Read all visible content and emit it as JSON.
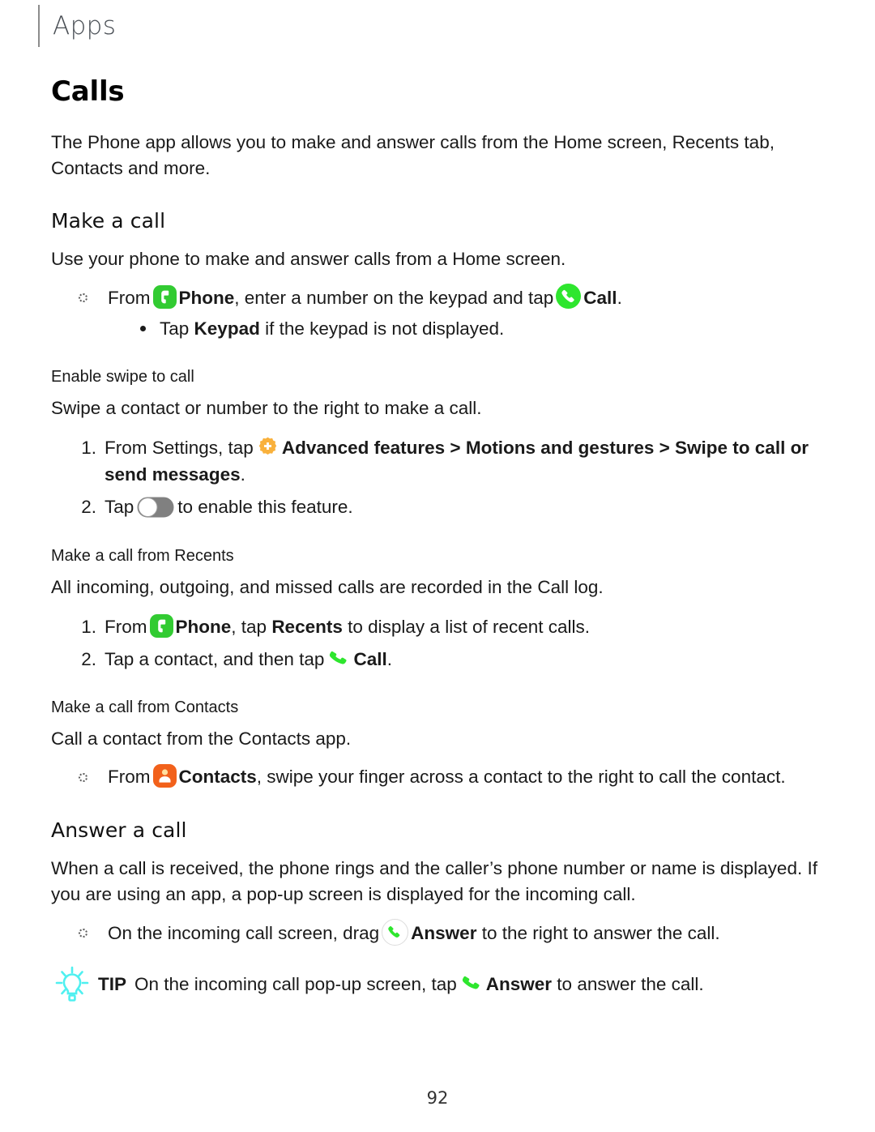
{
  "header": {
    "running_title": "Apps"
  },
  "chapter": {
    "title": "Calls",
    "intro": "The Phone app allows you to make and answer calls from the Home screen, Recents tab, Contacts and more."
  },
  "sections": {
    "make_a_call": {
      "title": "Make a call",
      "intro": "Use your phone to make and answer calls from a Home screen.",
      "bullet": {
        "text_1": "From",
        "app_label": "Phone",
        "text_2": ", enter a number on the keypad and tap",
        "action_label": "Call",
        "text_3": ".",
        "sub_text_1": "Tap",
        "sub_bold": "Keypad",
        "sub_text_2": "if the keypad is not displayed."
      }
    },
    "enable_swipe_to_call": {
      "title": "Enable swipe to call",
      "intro": "Swipe a contact or number to the right to make a call.",
      "steps": [
        {
          "num": "1.",
          "text_1": "From Settings, tap",
          "bold_1": "Advanced features",
          "sep_1": ">",
          "bold_2": "Motions and gestures",
          "sep_2": ">",
          "bold_3": "Swipe to call or send messages",
          "text_2": "."
        },
        {
          "num": "2.",
          "text_1": "Tap",
          "text_2": "to enable this feature."
        }
      ]
    },
    "call_from_recents": {
      "title": "Make a call from Recents",
      "intro": "All incoming, outgoing, and missed calls are recorded in the Call log.",
      "steps": [
        {
          "num": "1.",
          "text_1": "From",
          "app_label": "Phone",
          "text_2": ", tap",
          "bold_1": "Recents",
          "text_3": "to display a list of recent calls."
        },
        {
          "num": "2.",
          "text_1": "Tap a contact, and then tap",
          "action_label": "Call",
          "text_2": "."
        }
      ]
    },
    "call_from_contacts": {
      "title": "Make a call from Contacts",
      "intro": "Call a contact from the Contacts app.",
      "bullet": {
        "text_1": "From",
        "app_label": "Contacts",
        "text_2": ", swipe your finger across a contact to the right to call the contact."
      }
    },
    "answer_a_call": {
      "title": "Answer a call",
      "intro": "When a call is received, the phone rings and the caller’s phone number or name is displayed. If you are using an app, a pop-up screen is displayed for the incoming call.",
      "bullet": {
        "text_1": "On the incoming call screen, drag",
        "action_label": "Answer",
        "text_2": "to the right to answer the call."
      }
    }
  },
  "tip": {
    "label": "TIP",
    "text_1": "On the incoming call pop-up screen, tap",
    "action_label": "Answer",
    "text_2": "to answer the call."
  },
  "footer": {
    "page_number": "92"
  },
  "icons": {
    "phone_app": "phone-app-icon",
    "call": "call-icon",
    "contacts_app": "contacts-app-icon",
    "settings_gear": "advanced-features-gear-icon",
    "toggle": "toggle-switch-off-icon",
    "answer": "answer-call-icon",
    "tip_bulb": "lightbulb-tip-icon"
  },
  "colors": {
    "phone_green": "#32cb32",
    "call_green": "#2ee62e",
    "contacts_orange": "#f2611b",
    "gear_orange": "#f9b13c",
    "tip_cyan": "#4ff0f0",
    "toggle_gray": "#808080",
    "header_gray": "#4a4f55"
  }
}
